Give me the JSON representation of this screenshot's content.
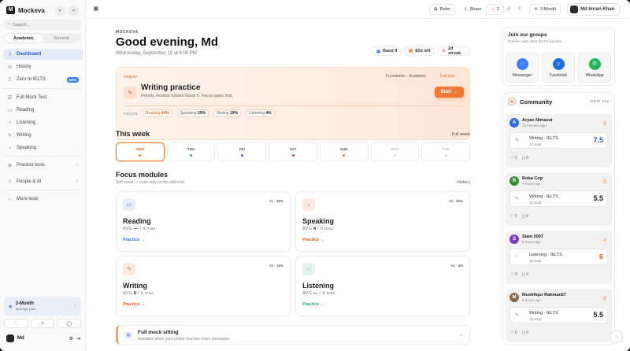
{
  "app": {
    "name": "Mockeva"
  },
  "sidebar": {
    "search_placeholder": "Search...",
    "tabs": [
      {
        "label": "Academic"
      },
      {
        "label": "General"
      }
    ],
    "items": [
      {
        "label": "Dashboard",
        "icon": "home-icon"
      },
      {
        "label": "History",
        "icon": "clock-icon"
      },
      {
        "label": "Zero to IELTS",
        "icon": "graduation-icon",
        "badge": "NEW"
      },
      {
        "label": "Full Mock Test",
        "icon": "list-icon"
      },
      {
        "label": "Reading",
        "icon": "book-icon"
      },
      {
        "label": "Listening",
        "icon": "headphones-icon"
      },
      {
        "label": "Writing",
        "icon": "pen-icon"
      },
      {
        "label": "Speaking",
        "icon": "mic-icon"
      },
      {
        "label": "Practice tools",
        "icon": "tool-icon"
      },
      {
        "label": "People & AI",
        "icon": "people-icon"
      },
      {
        "label": "More tools",
        "icon": "more-icon"
      }
    ],
    "plan": {
      "title": "3-Month",
      "subtitle": "Manage plan"
    },
    "user": {
      "name": "Md"
    }
  },
  "topbar": {
    "refer_label": "Refer",
    "share_label": "Share",
    "fire_count": "2",
    "plan_label": "3-Month",
    "user_name": "Md Imran Khan"
  },
  "greeting": {
    "eyebrow": "MOCKEVA",
    "title": "Good evening, Md",
    "date": "Wednesday, September 10 at 6:00 PM"
  },
  "stats": [
    {
      "label": "Band 9",
      "color": "#6b8cf0"
    },
    {
      "label": "82d left",
      "color": "#e8845a"
    },
    {
      "label": "2d streak",
      "color": "#e0553c"
    }
  ],
  "today": {
    "eyebrow": "TODAY",
    "track": "Foundation · Academic",
    "plan_link": "Full plan →",
    "title": "Writing practice",
    "subtitle": "Priority module toward Band 9. Focus gaps first.",
    "start_label": "Start",
    "focus_label": "FOCUS",
    "focus": [
      {
        "name": "Reading",
        "pct": "44%"
      },
      {
        "name": "Speaking",
        "pct": "29%"
      },
      {
        "name": "Writing",
        "pct": "19%"
      },
      {
        "name": "Listening",
        "pct": "4%"
      }
    ]
  },
  "week": {
    "title": "This week",
    "link": "Full week",
    "days": [
      {
        "label": "WED",
        "dot": "#ef7a35"
      },
      {
        "label": "THU",
        "dot": "#2aa876"
      },
      {
        "label": "FRI",
        "dot": "#3b6fd8"
      },
      {
        "label": "SAT",
        "dot": "#d94545"
      },
      {
        "label": "SUN",
        "dot": "#ef7a35"
      },
      {
        "label": "MON",
        "dot": "#d9d9d9"
      },
      {
        "label": "TUE",
        "dot": "#d9d9d9"
      }
    ]
  },
  "modules": {
    "title": "Focus modules",
    "hint": "Soft cards — color only on the skill icon",
    "history_link": "History",
    "practice_label": "Practice →",
    "cards": [
      {
        "name": "Reading",
        "rank": "#1 · 48%",
        "avg_label": "AVG",
        "avg": "—",
        "max": "/ 9 max",
        "color": "#3b6fd8",
        "bg": "#e8eefb",
        "icon": "book-icon"
      },
      {
        "name": "Speaking",
        "rank": "#2 · 29%",
        "avg_label": "AVG",
        "avg": "4",
        "max": "/ 9 max",
        "color": "#d9622a",
        "bg": "#fde9df",
        "icon": "mic-icon"
      },
      {
        "name": "Writing",
        "rank": "#3 · 19%",
        "avg_label": "AVG",
        "avg": "6",
        "max": "/ 9 max",
        "color": "#d9622a",
        "bg": "#fde9df",
        "icon": "pen-icon"
      },
      {
        "name": "Listening",
        "rank": "#4 · 4%",
        "avg_label": "AVG",
        "avg": "—",
        "max": "/ 9 max",
        "color": "#2aa876",
        "bg": "#e3f5ec",
        "icon": "headphones-icon"
      }
    ]
  },
  "mock": {
    "title": "Full mock sitting",
    "subtitle": "Available when your phase reaches exam simulation"
  },
  "groups": {
    "title": "Join our groups",
    "subtitle": "Connect with other IELTS learners",
    "items": [
      {
        "label": "Messenger",
        "color": "#3b82f6"
      },
      {
        "label": "Facebook",
        "color": "#1f6fe0"
      },
      {
        "label": "WhatsApp",
        "color": "#25b35a"
      }
    ]
  },
  "community": {
    "title": "Community",
    "view_all": "VIEW ALL",
    "posts": [
      {
        "initial": "A",
        "name": "Aryan Nimavat",
        "time": "25 minutes ago",
        "module": "Writing · IELTS",
        "date": "16 Sept",
        "score": "7.5",
        "likes": "0",
        "comments": "0",
        "avatar": "#2f6fd8",
        "score_color": "#2458c7"
      },
      {
        "initial": "R",
        "name": "Roba Cop",
        "time": "3 hours ago",
        "module": "Writing · IELTS",
        "date": "16 Sept",
        "score": "5.5",
        "likes": "0",
        "comments": "0",
        "avatar": "#3d8a3d",
        "score_color": "#222222"
      },
      {
        "initial": "S",
        "name": "Siam 0007",
        "time": "5 hours ago",
        "module": "Listening · IELTS",
        "date": "16 Sept",
        "score": "6",
        "likes": "0",
        "comments": "0",
        "avatar": "#7a3fb8",
        "score_color": "#e06b2c"
      },
      {
        "initial": "M",
        "name": "Mushfiqur Rahman57",
        "time": "5 hours ago",
        "module": "Writing · IELTS",
        "date": "16 Sept",
        "score": "5.5",
        "likes": "0",
        "comments": "0",
        "avatar": "#8a6a52",
        "score_color": "#222222"
      }
    ]
  }
}
